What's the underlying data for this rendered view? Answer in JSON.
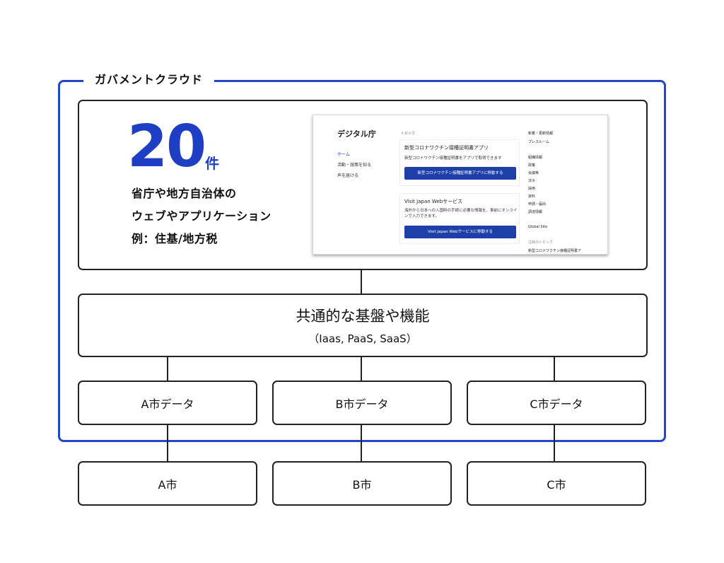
{
  "frame": {
    "title": "ガバメントクラウド",
    "accent_color": "#2347c8"
  },
  "summary": {
    "count": "20",
    "unit": "件",
    "lines": [
      "省庁や地方自治体の",
      "ウェブやアプリケーション",
      "例：住基/地方税"
    ]
  },
  "website": {
    "logo": "デジタル庁",
    "nav": [
      "ホーム",
      "活動・施策を知る",
      "声を届ける"
    ],
    "topics_label": "トピック",
    "cards": [
      {
        "title": "新型コロナワクチン接種証明書アプリ",
        "text": "新型コロナワクチン接種証明書をアプリで取得できます",
        "button": "新型コロナワクチン接種証明書アプリに移動する"
      },
      {
        "title": "Visit Japan Webサービス",
        "text": "海外から日本への入国時の手続に必要な情報を、事前にオンラインで入力できます。",
        "button": "Visit Japan Webサービスに移動する"
      }
    ],
    "side_links": [
      "新着・更新情報",
      "プレスルーム",
      "組織情報",
      "政策",
      "会議等",
      "法令",
      "採用",
      "資料",
      "申請・届出",
      "調達情報",
      "Global Site",
      "注目のトピック",
      "新型コロナワクチン接種証明書ア"
    ]
  },
  "platform": {
    "title": "共通的な基盤や機能",
    "subtitle": "（Iaas, PaaS, SaaS）"
  },
  "city_data": [
    "A市データ",
    "B市データ",
    "C市データ"
  ],
  "cities": [
    "A市",
    "B市",
    "C市"
  ]
}
